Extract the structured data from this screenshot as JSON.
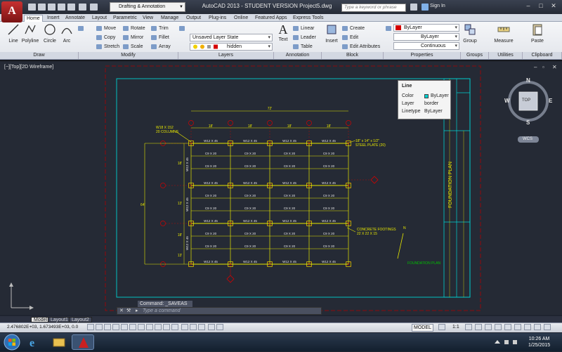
{
  "title_bar": {
    "app_button": "A",
    "workspace": "Drafting & Annotation",
    "title": "AutoCAD 2013 - STUDENT VERSION    Project5.dwg",
    "search_placeholder": "Type a keyword or phrase",
    "sign_in": "Sign In"
  },
  "tabs": [
    "Home",
    "Insert",
    "Annotate",
    "Layout",
    "Parametric",
    "View",
    "Manage",
    "Output",
    "Plug-ins",
    "Online",
    "Featured Apps",
    "Express Tools"
  ],
  "ribbon": {
    "draw": {
      "label": "Draw",
      "line": "Line",
      "polyline": "Polyline",
      "circle": "Circle",
      "arc": "Arc"
    },
    "modify": {
      "label": "Modify",
      "move": "Move",
      "rotate": "Rotate",
      "trim": "Trim",
      "copy": "Copy",
      "mirror": "Mirror",
      "fillet": "Fillet",
      "stretch": "Stretch",
      "scale": "Scale",
      "array": "Array"
    },
    "layers": {
      "label": "Layers",
      "state": "Unsaved Layer State",
      "current": "hidden"
    },
    "annotation": {
      "label": "Annotation",
      "text": "Text",
      "linear": "Linear",
      "leader": "Leader",
      "table": "Table"
    },
    "block": {
      "label": "Block",
      "insert": "Insert",
      "create": "Create",
      "edit": "Edit",
      "edit_attributes": "Edit Attributes"
    },
    "properties": {
      "label": "Properties",
      "color": "ByLayer",
      "lineweight": "ByLayer",
      "linetype": "Continuous"
    },
    "groups": {
      "label": "Groups",
      "group": "Group"
    },
    "utilities": {
      "label": "Utilities",
      "measure": "Measure"
    },
    "clipboard": {
      "label": "Clipboard",
      "paste": "Paste"
    }
  },
  "viewport": {
    "label": "[−][Top][2D Wireframe]"
  },
  "drawing": {
    "overall_dim": "72'",
    "span_dims": [
      "18'",
      "18'",
      "18'",
      "18'"
    ],
    "row_dims": [
      "18'",
      "13'",
      "18'",
      "13'"
    ],
    "side_dim": "64'",
    "column_note": [
      "W18 X 152",
      "20 COLUMNS"
    ],
    "plate_note": [
      "18\" x 14\" x 1/2\"",
      "STEEL PLATE (20)"
    ],
    "footing_note": [
      "CONCRETE FOOTINGS",
      "22 X 22 X 15"
    ],
    "girder_label": "W12 X 45",
    "joist_label": "C9 X 20",
    "plan_label": "FOUNDATION PLAN",
    "north": "N",
    "title_block_main": "FOUNDATION PLAN"
  },
  "tooltip": {
    "title": "Line",
    "color_label": "Color",
    "color_value": "ByLayer",
    "layer_label": "Layer",
    "layer_value": "border",
    "linetype_label": "Linetype",
    "linetype_value": "ByLayer"
  },
  "nav_cube": {
    "n": "N",
    "s": "S",
    "e": "E",
    "w": "W",
    "face": "TOP",
    "wcs": "WCS"
  },
  "command": {
    "history_label": "Command:",
    "history_value": "_SAVEAS",
    "placeholder": "Type a command"
  },
  "layout_tabs": [
    "Model",
    "Layout1",
    "Layout2"
  ],
  "status": {
    "coords": "2.476802E+03, 1.673493E+03, 0.0",
    "model": "MODEL",
    "scale": "1:1"
  },
  "clock": {
    "time": "10:26 AM",
    "date": "1/25/2015"
  },
  "colors": {
    "accent_red": "#d40000",
    "drawing_yellow": "#e6e600",
    "drawing_cyan": "#00d0d0",
    "drawing_green": "#00c000"
  }
}
